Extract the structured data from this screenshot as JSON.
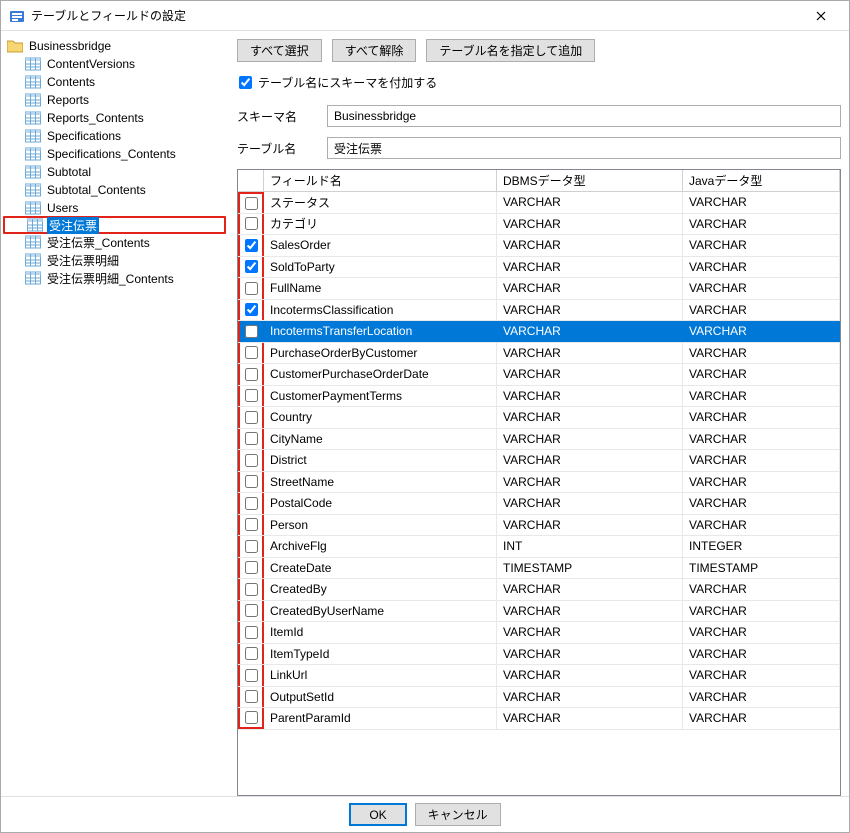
{
  "window": {
    "title": "テーブルとフィールドの設定"
  },
  "tree": {
    "root": "Businessbridge",
    "items": [
      {
        "label": "ContentVersions"
      },
      {
        "label": "Contents"
      },
      {
        "label": "Reports"
      },
      {
        "label": "Reports_Contents"
      },
      {
        "label": "Specifications"
      },
      {
        "label": "Specifications_Contents"
      },
      {
        "label": "Subtotal"
      },
      {
        "label": "Subtotal_Contents"
      },
      {
        "label": "Users"
      },
      {
        "label": "受注伝票",
        "selected": true,
        "highlight": true
      },
      {
        "label": "受注伝票_Contents"
      },
      {
        "label": "受注伝票明細"
      },
      {
        "label": "受注伝票明細_Contents"
      }
    ]
  },
  "toolbar": {
    "select_all": "すべて選択",
    "deselect_all": "すべて解除",
    "add_by_name": "テーブル名を指定して追加"
  },
  "options": {
    "append_schema_label": "テーブル名にスキーマを付加する",
    "append_schema_checked": true
  },
  "form": {
    "schema_label": "スキーマ名",
    "schema_value": "Businessbridge",
    "table_label": "テーブル名",
    "table_value": "受注伝票"
  },
  "grid": {
    "headers": {
      "field": "フィールド名",
      "dbms": "DBMSデータ型",
      "java": "Javaデータ型"
    },
    "rows": [
      {
        "checked": false,
        "field": "ステータス",
        "dbms": "VARCHAR",
        "java": "VARCHAR"
      },
      {
        "checked": false,
        "field": "カテゴリ",
        "dbms": "VARCHAR",
        "java": "VARCHAR"
      },
      {
        "checked": true,
        "field": "SalesOrder",
        "dbms": "VARCHAR",
        "java": "VARCHAR"
      },
      {
        "checked": true,
        "field": "SoldToParty",
        "dbms": "VARCHAR",
        "java": "VARCHAR"
      },
      {
        "checked": false,
        "field": "FullName",
        "dbms": "VARCHAR",
        "java": "VARCHAR"
      },
      {
        "checked": true,
        "field": "IncotermsClassification",
        "dbms": "VARCHAR",
        "java": "VARCHAR"
      },
      {
        "checked": false,
        "field": "IncotermsTransferLocation",
        "dbms": "VARCHAR",
        "java": "VARCHAR",
        "selected": true
      },
      {
        "checked": false,
        "field": "PurchaseOrderByCustomer",
        "dbms": "VARCHAR",
        "java": "VARCHAR"
      },
      {
        "checked": false,
        "field": "CustomerPurchaseOrderDate",
        "dbms": "VARCHAR",
        "java": "VARCHAR"
      },
      {
        "checked": false,
        "field": "CustomerPaymentTerms",
        "dbms": "VARCHAR",
        "java": "VARCHAR"
      },
      {
        "checked": false,
        "field": "Country",
        "dbms": "VARCHAR",
        "java": "VARCHAR"
      },
      {
        "checked": false,
        "field": "CityName",
        "dbms": "VARCHAR",
        "java": "VARCHAR"
      },
      {
        "checked": false,
        "field": "District",
        "dbms": "VARCHAR",
        "java": "VARCHAR"
      },
      {
        "checked": false,
        "field": "StreetName",
        "dbms": "VARCHAR",
        "java": "VARCHAR"
      },
      {
        "checked": false,
        "field": "PostalCode",
        "dbms": "VARCHAR",
        "java": "VARCHAR"
      },
      {
        "checked": false,
        "field": "Person",
        "dbms": "VARCHAR",
        "java": "VARCHAR"
      },
      {
        "checked": false,
        "field": "ArchiveFlg",
        "dbms": "INT",
        "java": "INTEGER"
      },
      {
        "checked": false,
        "field": "CreateDate",
        "dbms": "TIMESTAMP",
        "java": "TIMESTAMP"
      },
      {
        "checked": false,
        "field": "CreatedBy",
        "dbms": "VARCHAR",
        "java": "VARCHAR"
      },
      {
        "checked": false,
        "field": "CreatedByUserName",
        "dbms": "VARCHAR",
        "java": "VARCHAR"
      },
      {
        "checked": false,
        "field": "ItemId",
        "dbms": "VARCHAR",
        "java": "VARCHAR"
      },
      {
        "checked": false,
        "field": "ItemTypeId",
        "dbms": "VARCHAR",
        "java": "VARCHAR"
      },
      {
        "checked": false,
        "field": "LinkUrl",
        "dbms": "VARCHAR",
        "java": "VARCHAR"
      },
      {
        "checked": false,
        "field": "OutputSetId",
        "dbms": "VARCHAR",
        "java": "VARCHAR"
      },
      {
        "checked": false,
        "field": "ParentParamId",
        "dbms": "VARCHAR",
        "java": "VARCHAR"
      }
    ]
  },
  "footer": {
    "ok": "OK",
    "cancel": "キャンセル"
  }
}
